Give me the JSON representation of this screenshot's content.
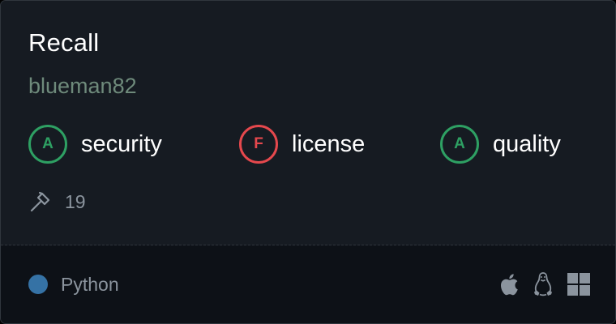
{
  "card": {
    "title": "Recall",
    "owner": "blueman82"
  },
  "scores": [
    {
      "grade": "A",
      "label": "security",
      "status": "good",
      "color": "#2ea063"
    },
    {
      "grade": "F",
      "label": "license",
      "status": "bad",
      "color": "#e5484d"
    },
    {
      "grade": "A",
      "label": "quality",
      "status": "good",
      "color": "#2ea063"
    }
  ],
  "builds": {
    "icon": "hammer-icon",
    "count": "19"
  },
  "language": {
    "name": "Python",
    "color": "#3572a5"
  },
  "platforms": [
    {
      "icon": "apple-icon",
      "name": "macOS"
    },
    {
      "icon": "linux-icon",
      "name": "Linux"
    },
    {
      "icon": "windows-icon",
      "name": "Windows"
    }
  ]
}
